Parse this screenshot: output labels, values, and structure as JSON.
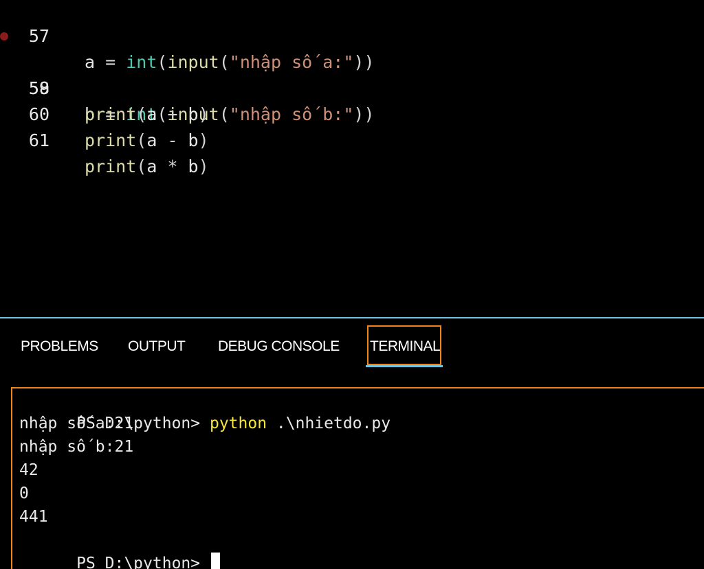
{
  "editor": {
    "lines": [
      {
        "number": "57",
        "breakpoint": false,
        "tokens": [
          {
            "t": "var",
            "v": "a"
          },
          {
            "t": "op",
            "v": " = "
          },
          {
            "t": "type",
            "v": "int"
          },
          {
            "t": "punct",
            "v": "("
          },
          {
            "t": "fn",
            "v": "input"
          },
          {
            "t": "punct",
            "v": "("
          },
          {
            "t": "str",
            "v": "\"nhập số a:\""
          },
          {
            "t": "punct",
            "v": "))"
          }
        ]
      },
      {
        "number": "58",
        "breakpoint": true,
        "tokens": [
          {
            "t": "var",
            "v": "b"
          },
          {
            "t": "op",
            "v": " = "
          },
          {
            "t": "type",
            "v": "int"
          },
          {
            "t": "punct",
            "v": "("
          },
          {
            "t": "fn",
            "v": "input"
          },
          {
            "t": "punct",
            "v": "("
          },
          {
            "t": "str",
            "v": "\"nhập số b:\""
          },
          {
            "t": "punct",
            "v": "))"
          }
        ]
      },
      {
        "number": "59",
        "breakpoint": false,
        "tokens": [
          {
            "t": "fn",
            "v": "print"
          },
          {
            "t": "punct",
            "v": "("
          },
          {
            "t": "var",
            "v": "a"
          },
          {
            "t": "op",
            "v": " + "
          },
          {
            "t": "var",
            "v": "b"
          },
          {
            "t": "punct",
            "v": ")"
          }
        ]
      },
      {
        "number": "60",
        "breakpoint": false,
        "tokens": [
          {
            "t": "fn",
            "v": "print"
          },
          {
            "t": "punct",
            "v": "("
          },
          {
            "t": "var",
            "v": "a"
          },
          {
            "t": "op",
            "v": " - "
          },
          {
            "t": "var",
            "v": "b"
          },
          {
            "t": "punct",
            "v": ")"
          }
        ]
      },
      {
        "number": "61",
        "breakpoint": false,
        "tokens": [
          {
            "t": "fn",
            "v": "print"
          },
          {
            "t": "punct",
            "v": "("
          },
          {
            "t": "var",
            "v": "a"
          },
          {
            "t": "op",
            "v": " * "
          },
          {
            "t": "var",
            "v": "b"
          },
          {
            "t": "punct",
            "v": ")"
          }
        ]
      }
    ]
  },
  "panel": {
    "tabs": {
      "problems": "PROBLEMS",
      "output": "OUTPUT",
      "debug_console": "DEBUG CONSOLE",
      "terminal": "TERMINAL"
    },
    "active_tab": "terminal"
  },
  "terminal": {
    "prompt": "PS D:\\python> ",
    "command": "python",
    "command_args": " .\\nhietdo.py",
    "output_lines": [
      "nhập số a:21",
      "nhập số b:21",
      "42",
      "0",
      "441"
    ],
    "final_prompt": "PS D:\\python> "
  },
  "colors": {
    "background": "#000000",
    "focus_border": "#f38518",
    "panel_border": "#6fc3df",
    "command_highlight": "#f5e53b",
    "breakpoint": "#8b1a1a"
  }
}
